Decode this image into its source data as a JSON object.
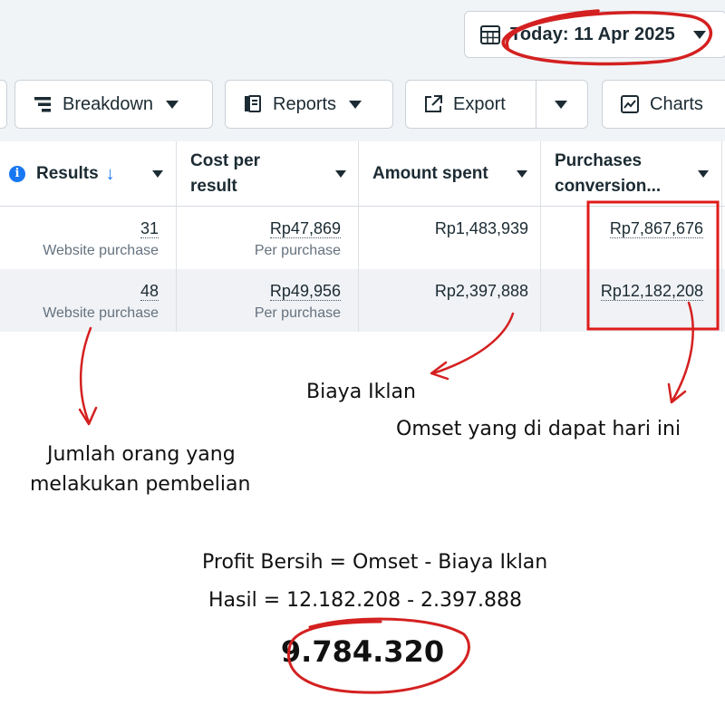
{
  "date_filter": {
    "label": "Today: 11 Apr 2025",
    "icon": "calendar-icon"
  },
  "toolbar": {
    "breakdown_label": "Breakdown",
    "reports_label": "Reports",
    "export_label": "Export",
    "charts_label": "Charts"
  },
  "table": {
    "headers": [
      {
        "label": "Results",
        "sort": "↓"
      },
      {
        "label_line1": "Cost per",
        "label_line2": "result"
      },
      {
        "label": "Amount spent"
      },
      {
        "label_line1": "Purchases",
        "label_line2": "conversion..."
      }
    ],
    "rows": [
      {
        "results": "31",
        "results_sub": "Website purchase",
        "cost_per_result": "Rp47,869",
        "cost_sub": "Per purchase",
        "amount_spent": "Rp1,483,939",
        "purchases_conversion": "Rp7,867,676"
      },
      {
        "results": "48",
        "results_sub": "Website purchase",
        "cost_per_result": "Rp49,956",
        "cost_sub": "Per purchase",
        "amount_spent": "Rp2,397,888",
        "purchases_conversion": "Rp12,182,208"
      }
    ]
  },
  "annotations": {
    "ad_cost": "Biaya Iklan",
    "revenue": "Omset yang di dapat hari ini",
    "buyers_line1": "Jumlah orang yang",
    "buyers_line2": "melakukan pembelian",
    "formula": "Profit Bersih = Omset - Biaya Iklan",
    "calculation": "Hasil = 12.182.208 - 2.397.888",
    "result": "9.784.320"
  },
  "colors": {
    "annotation_red": "#d42020",
    "accent_blue": "#1877f2",
    "toolbar_bg": "#f1f4f7"
  }
}
